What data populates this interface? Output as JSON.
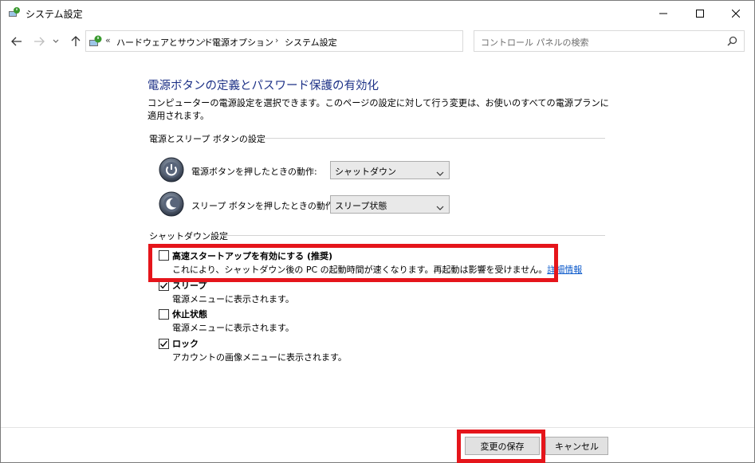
{
  "window": {
    "title": "システム設定",
    "icon": "power-options-icon"
  },
  "nav": {
    "breadcrumb_prefix": "«",
    "breadcrumbs": [
      "ハードウェアとサウンド",
      "電源オプション",
      "システム設定"
    ],
    "search_placeholder": "コントロール パネルの検索"
  },
  "page": {
    "title": "電源ボタンの定義とパスワード保護の有効化",
    "description": "コンピューターの電源設定を選択できます。このページの設定に対して行う変更は、お使いのすべての電源プランに適用されます。"
  },
  "power_buttons": {
    "group_label": "電源とスリープ ボタンの設定",
    "power_row": {
      "label": "電源ボタンを押したときの動作:",
      "value": "シャットダウン"
    },
    "sleep_row": {
      "label": "スリープ ボタンを押したときの動作:",
      "value": "スリープ状態"
    }
  },
  "shutdown": {
    "group_label": "シャットダウン設定",
    "items": [
      {
        "title": "高速スタートアップを有効にする (推奨)",
        "desc": "これにより、シャットダウン後の PC の起動時間が速くなります。再起動は影響を受けません。",
        "link": "詳細情報",
        "checked": false
      },
      {
        "title": "スリープ",
        "desc": "電源メニューに表示されます。",
        "checked": true
      },
      {
        "title": "休止状態",
        "desc": "電源メニューに表示されます。",
        "checked": false
      },
      {
        "title": "ロック",
        "desc": "アカウントの画像メニューに表示されます。",
        "checked": true
      }
    ]
  },
  "footer": {
    "save_label": "変更の保存",
    "cancel_label": "キャンセル"
  },
  "colors": {
    "title": "#1e3287",
    "highlight": "#e5151b",
    "link": "#0a58ca"
  }
}
